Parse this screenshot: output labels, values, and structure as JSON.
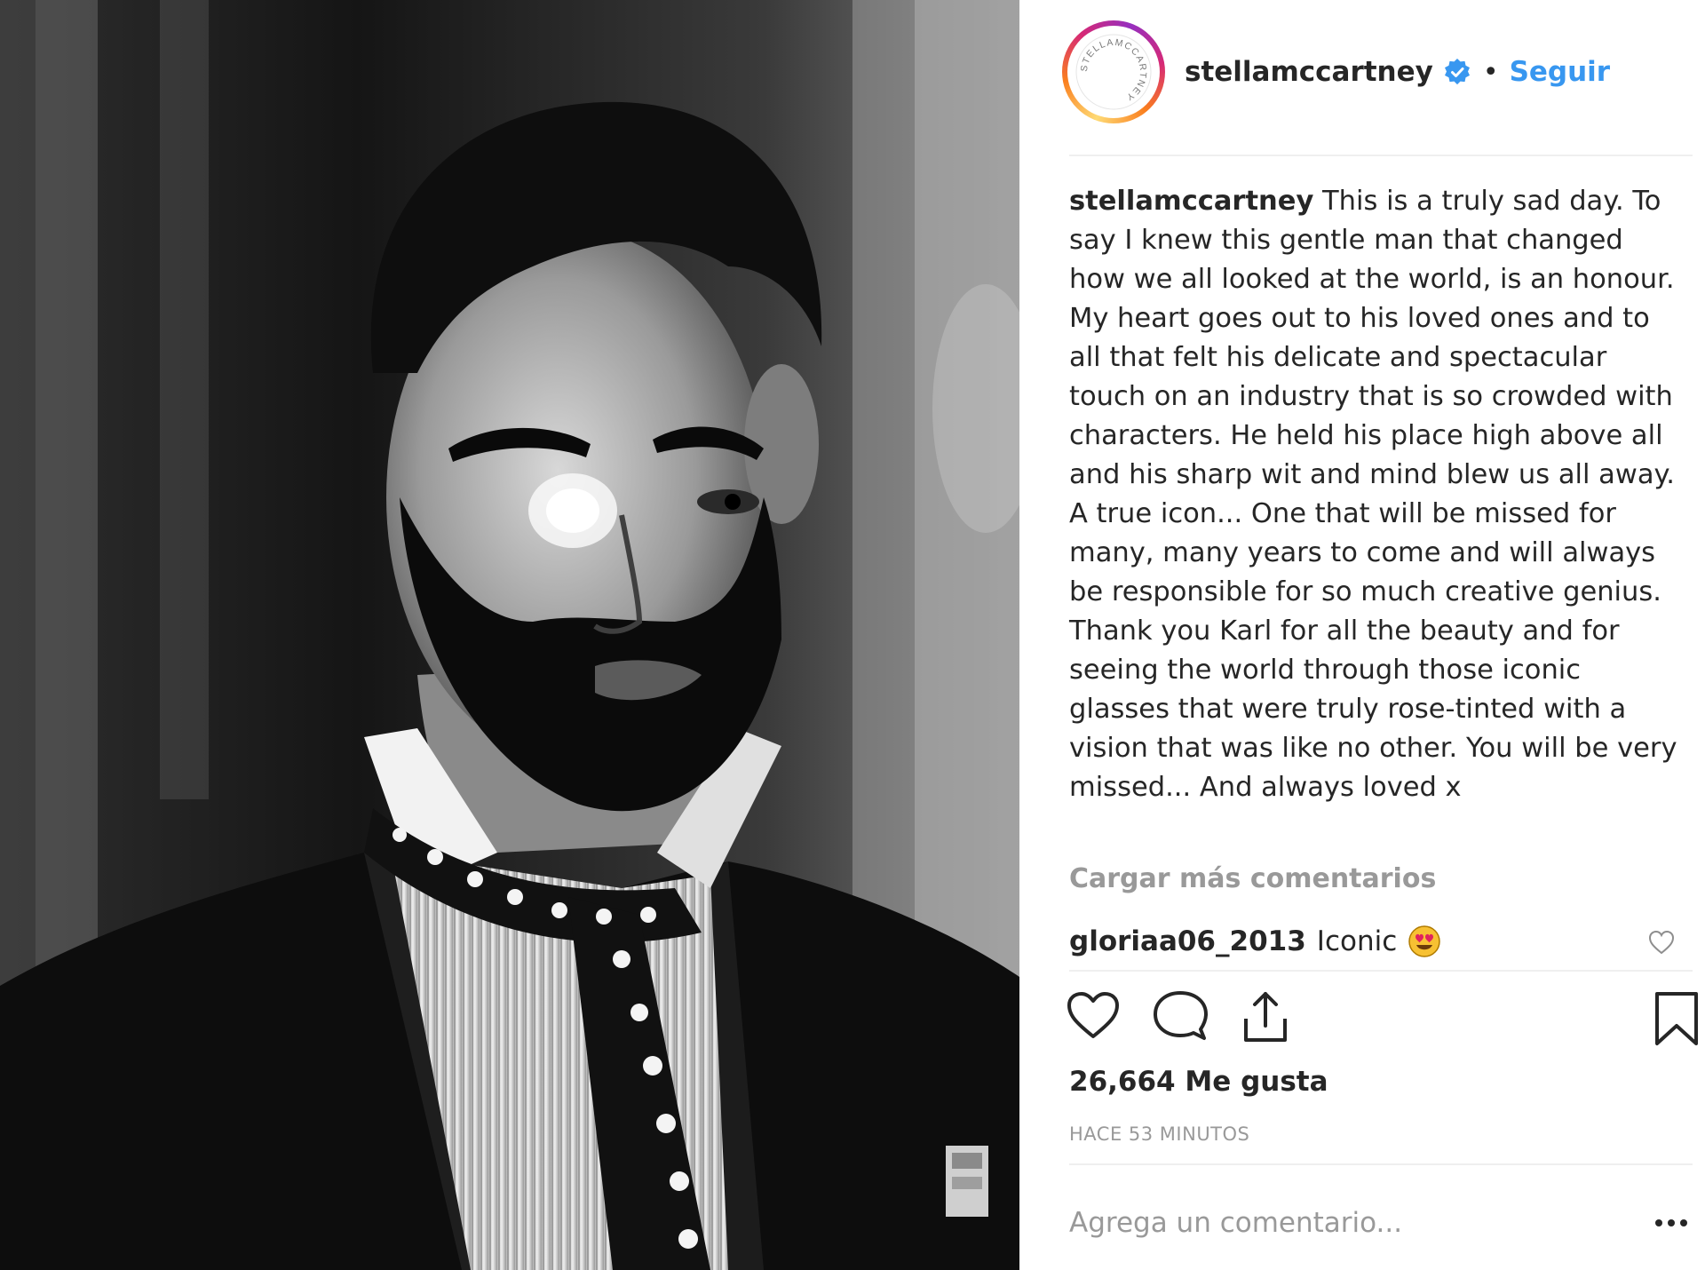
{
  "post": {
    "username": "stellamccartney",
    "follow_label": "Seguir",
    "separator": "•",
    "avatar_ring_text": "STELLAMCCARTNEY",
    "caption": {
      "username": "stellamccartney",
      "text": "This is a truly sad day. To say I knew this gentle man that changed how we all looked at the world, is an honour. My heart goes out to his loved ones and to all that felt his delicate and spectacular touch on an industry that is so crowded with characters. He held his place high above all and his sharp wit and mind blew us all away. A true icon... One that will be missed for many, many years to come and will always be responsible for so much creative genius. Thank you Karl for all the beauty and for seeing the world through those iconic glasses that were truly rose-tinted with a vision that was like no other. You will be very missed... And always loved x"
    },
    "load_more_label": "Cargar más comentarios",
    "comments": [
      {
        "username": "gloriaa06_2013",
        "text": "Iconic",
        "emoji": "😍"
      }
    ],
    "likes_text": "26,664 Me gusta",
    "timestamp": "HACE 53 MINUTOS",
    "add_comment_placeholder": "Agrega un comentario...",
    "more_options_icon": "•••"
  },
  "icons": {
    "verified": "verified-badge-icon",
    "like": "heart-icon",
    "comment": "comment-bubble-icon",
    "share": "share-icon",
    "save": "bookmark-icon",
    "comment_like": "small-heart-icon",
    "more": "more-options-icon"
  },
  "colors": {
    "link_blue": "#3897f0",
    "verified_blue": "#3897f0",
    "text": "#262626",
    "muted": "#999999",
    "divider": "#efefef"
  }
}
